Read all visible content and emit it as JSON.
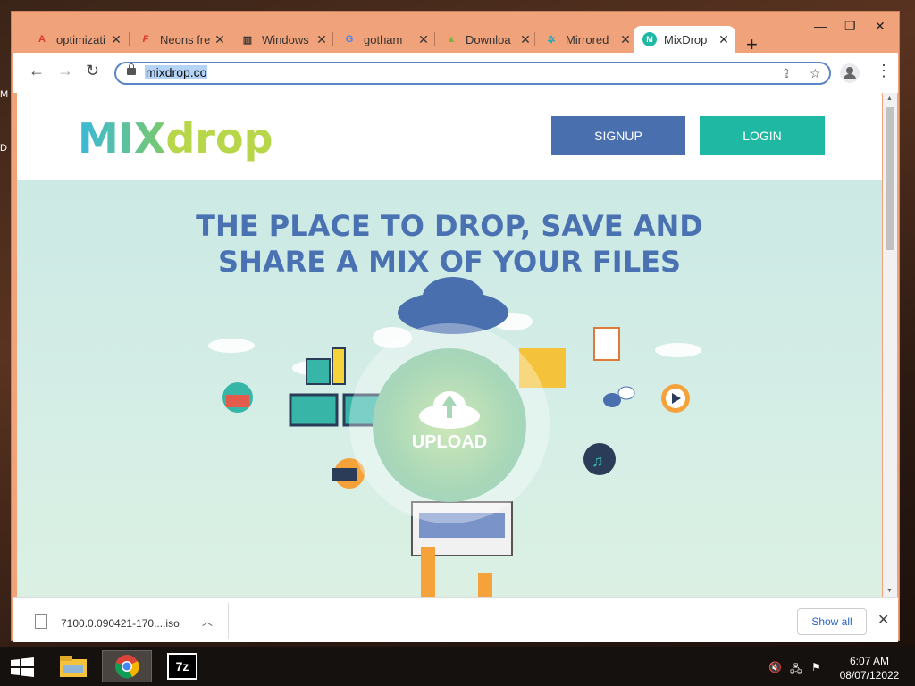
{
  "browser": {
    "tabs": [
      {
        "title": "optimizati",
        "icon": "adobe-icon",
        "color": "#d83b2b"
      },
      {
        "title": "Neons fre",
        "icon": "font-f-icon",
        "color": "#d83b2b"
      },
      {
        "title": "Windows",
        "icon": "library-icon",
        "color": "#333333"
      },
      {
        "title": "gotham",
        "icon": "google-icon",
        "color": "#4285f4"
      },
      {
        "title": "Downloa",
        "icon": "android-icon",
        "color": "#7cb342"
      },
      {
        "title": "Mirrored",
        "icon": "gear-icon",
        "color": "#1fa9b8"
      },
      {
        "title": "MixDrop",
        "icon": "mixdrop-icon",
        "color": "#1fb8a2"
      }
    ],
    "active_tab": 6,
    "url": "mixdrop.co",
    "download": {
      "filename": "7100.0.090421-170....iso",
      "show_all": "Show all"
    }
  },
  "site": {
    "logo_mix": "MIX",
    "logo_drop": "drop",
    "signup": "SIGNUP",
    "login": "LOGIN",
    "headline_1": "THE PLACE TO DROP, SAVE AND",
    "headline_2": "SHARE A MIX OF YOUR FILES",
    "upload": "UPLOAD"
  },
  "taskbar": {
    "time": "6:07 AM",
    "date": "08/07/12022",
    "apps": [
      "file-explorer-icon",
      "chrome-icon",
      "7zip-icon"
    ],
    "sevenzip_label": "7z"
  },
  "desktop": {
    "left_labels": [
      "M",
      "D"
    ]
  }
}
